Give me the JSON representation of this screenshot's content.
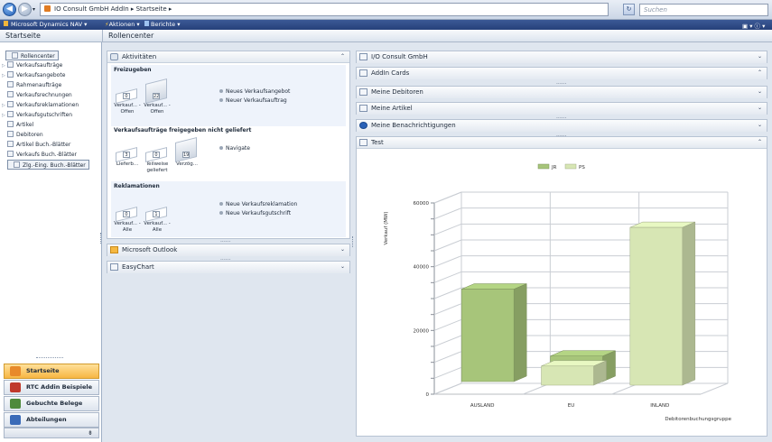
{
  "window": {
    "breadcrumb": "IO Consult GmbH AddIn ▸ Startseite ▸",
    "search_placeholder": "Suchen"
  },
  "cmdbar": {
    "app": "Microsoft Dynamics NAV ▾",
    "actions": "Aktionen ▾",
    "reports": "Berichte ▾",
    "right": "▣ ▾  ⓘ ▾"
  },
  "nav": {
    "title": "Startseite",
    "items": [
      {
        "label": "Rollencenter",
        "expand": ""
      },
      {
        "label": "Verkaufsaufträge",
        "expand": "▷"
      },
      {
        "label": "Verkaufsangebote",
        "expand": "▷"
      },
      {
        "label": "Rahmenaufträge",
        "expand": ""
      },
      {
        "label": "Verkaufsrechnungen",
        "expand": ""
      },
      {
        "label": "Verkaufsreklamationen",
        "expand": "▷"
      },
      {
        "label": "Verkaufsgutschriften",
        "expand": "▷"
      },
      {
        "label": "Artikel",
        "expand": ""
      },
      {
        "label": "Debitoren",
        "expand": ""
      },
      {
        "label": "Artikel Buch.-Blätter",
        "expand": ""
      },
      {
        "label": "Verkaufs Buch.-Blätter",
        "expand": ""
      },
      {
        "label": "Zlg.-Eing. Buch.-Blätter",
        "expand": ""
      }
    ],
    "buttons": [
      {
        "label": "Startseite",
        "color": "#e88a2a"
      },
      {
        "label": "RTC Addin Beispiele",
        "color": "#c0392b"
      },
      {
        "label": "Gebuchte Belege",
        "color": "#4f8a3c"
      },
      {
        "label": "Abteilungen",
        "color": "#3b6bb8"
      }
    ],
    "footer": "⇟"
  },
  "center": {
    "title": "Rollencenter",
    "activities": {
      "title": "Aktivitäten",
      "sections": [
        {
          "title": "Freizugeben",
          "cues": [
            {
              "value": "0",
              "label": "Verkauf... - Offen"
            },
            {
              "value": "22",
              "label": "Verkauf... - Offen"
            }
          ],
          "actions": [
            "Neues Verkaufsangebot",
            "Neuer Verkaufsauftrag"
          ]
        },
        {
          "title": "Verkaufsaufträge freigegeben nicht geliefert",
          "cues": [
            {
              "value": "3",
              "label": "Lieferb..."
            },
            {
              "value": "0",
              "label": "Teilweise geliefert"
            },
            {
              "value": "19",
              "label": "Verzög..."
            }
          ],
          "actions": [
            "Navigate"
          ]
        },
        {
          "title": "Reklamationen",
          "cues": [
            {
              "value": "0",
              "label": "Verkauf... - Alle"
            },
            {
              "value": "1",
              "label": "Verkauf... - Alle"
            }
          ],
          "actions": [
            "Neue Verkaufsreklamation",
            "Neue Verkaufsgutschrift"
          ]
        }
      ]
    },
    "outlook": "Microsoft Outlook",
    "easychart": "EasyChart",
    "dots": "......"
  },
  "right": {
    "parts": [
      "I/O Consult GmbH",
      "AddIn Cards",
      "Meine Debitoren",
      "Meine Artikel",
      "Meine Benachrichtigungen",
      "Test"
    ],
    "chevrons": [
      "⌄",
      "⌃",
      "⌄",
      "⌄",
      "⌄",
      "⌃"
    ]
  },
  "colors": {
    "jr": "#a7c57a",
    "ps": "#d7e6b4"
  },
  "chart_data": {
    "type": "bar",
    "categories": [
      "AUSLAND",
      "EU",
      "INLAND"
    ],
    "series": [
      {
        "name": "JR",
        "values": [
          29000,
          8000,
          0
        ]
      },
      {
        "name": "PS",
        "values": [
          0,
          6000,
          49500
        ]
      }
    ],
    "xlabel": "Debitorenbuchungsgruppe",
    "ylabel": "Verkauf (MW)",
    "ylim": [
      0,
      60000
    ],
    "yticks": [
      "0",
      "20000",
      "40000",
      "60000"
    ],
    "grid": true,
    "legend": "top"
  }
}
